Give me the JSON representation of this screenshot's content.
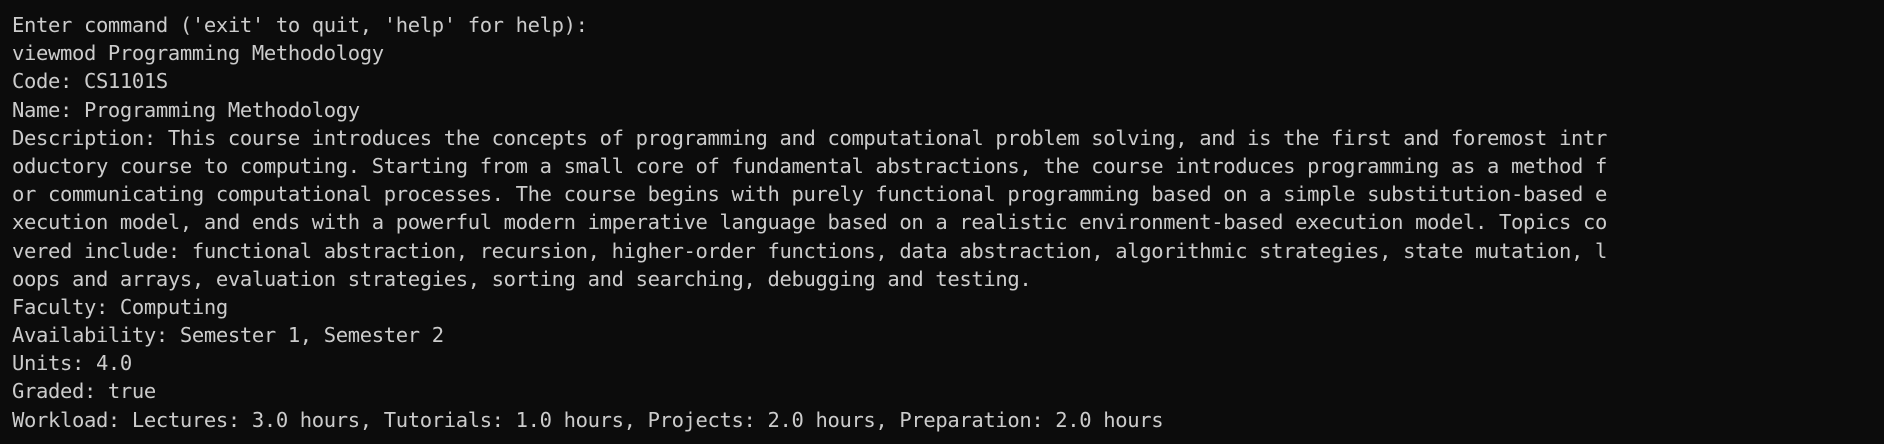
{
  "terminal": {
    "prompt": "Enter command ('exit' to quit, 'help' for help):",
    "command": "viewmod Programming Methodology",
    "output": {
      "code": "Code: CS1101S",
      "name": "Name: Programming Methodology",
      "description_lines": [
        "Description: This course introduces the concepts of programming and computational problem solving, and is the first and foremost intr",
        "oductory course to computing. Starting from a small core of fundamental abstractions, the course introduces programming as a method f",
        "or communicating computational processes. The course begins with purely functional programming based on a simple substitution-based e",
        "xecution model, and ends with a powerful modern imperative language based on a realistic environment-based execution model. Topics co",
        "vered include: functional abstraction, recursion, higher-order functions, data abstraction, algorithmic strategies, state mutation, l",
        "oops and arrays, evaluation strategies, sorting and searching, debugging and testing."
      ],
      "faculty": "Faculty: Computing",
      "availability": "Availability: Semester 1, Semester 2",
      "units": "Units: 4.0",
      "graded": "Graded: true",
      "workload": "Workload: Lectures: 3.0 hours, Tutorials: 1.0 hours, Projects: 2.0 hours, Preparation: 2.0 hours"
    }
  },
  "colors": {
    "background": "#0c0c0c",
    "foreground": "#cccccc"
  }
}
